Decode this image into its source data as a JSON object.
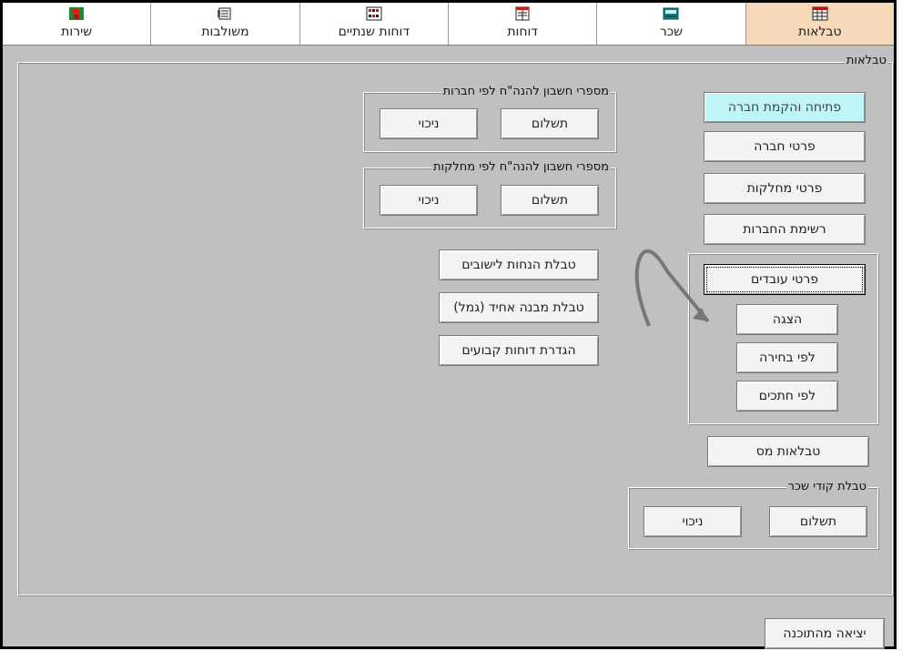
{
  "tabs": [
    {
      "label": "שירות",
      "icon": "service-icon",
      "active": false
    },
    {
      "label": "משולבות",
      "icon": "combined-icon",
      "active": false
    },
    {
      "label": "דוחות שנתיים",
      "icon": "annual-reports-icon",
      "active": false
    },
    {
      "label": "דוחות",
      "icon": "reports-icon",
      "active": false
    },
    {
      "label": "שכר",
      "icon": "salary-icon",
      "active": false
    },
    {
      "label": "טבלאות",
      "icon": "tables-icon",
      "active": true
    }
  ],
  "main": {
    "legend": "טבלאות",
    "right_buttons": {
      "open_company": "פתיחה והקמת חברה",
      "company_details": "פרטי חברה",
      "department_details": "פרטי מחלקות",
      "companies_list": "רשימת החברות"
    },
    "employees": {
      "details": "פרטי עובדים",
      "display": "הצגה",
      "by_selection": "לפי בחירה",
      "by_sections": "לפי חתכים"
    },
    "tax_tables": "טבלאות מס",
    "salary_codes": {
      "legend": "טבלת קודי שכר",
      "payment": "תשלום",
      "deduction": "ניכוי"
    },
    "company_accounts": {
      "legend": "מספרי חשבון להנה\"ח לפי חברות",
      "payment": "תשלום",
      "deduction": "ניכוי"
    },
    "department_accounts": {
      "legend": "מספרי חשבון להנה\"ח לפי מחלקות",
      "payment": "תשלום",
      "deduction": "ניכוי"
    },
    "settlement_discounts": "טבלת הנחות לישובים",
    "uniform_structure": "טבלת מבנה אחיד (גמל)",
    "fixed_reports": "הגדרת דוחות קבועים"
  },
  "exit": "יציאה מהתוכנה",
  "colors": {
    "active_tab": "#f6d9b8",
    "panel": "#c0c0c0",
    "open_company_button": "#bff5f6",
    "arrow": "#777777"
  }
}
